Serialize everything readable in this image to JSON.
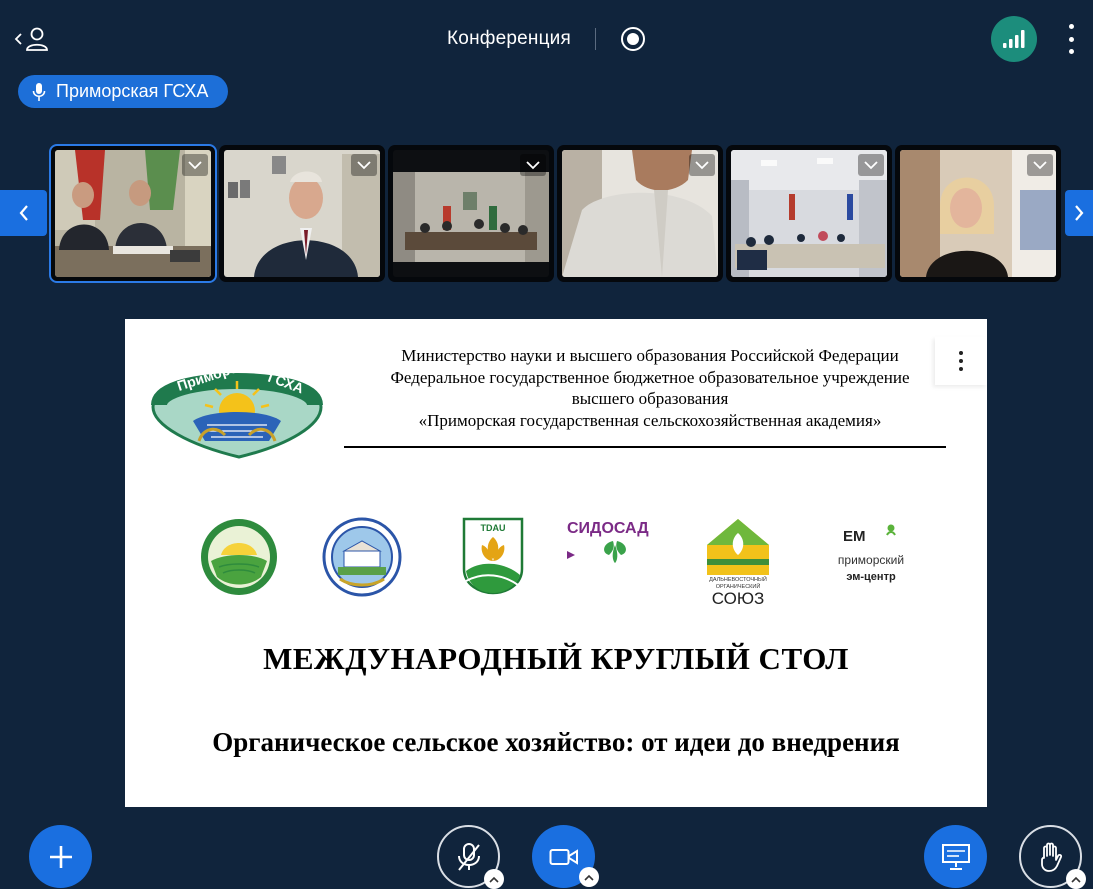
{
  "header": {
    "title": "Конференция"
  },
  "speaker": {
    "name": "Приморская ГСХА"
  },
  "strip": {
    "tiles": [
      {
        "scene": "two-men-at-desk",
        "active": true
      },
      {
        "scene": "man-in-suit-office"
      },
      {
        "scene": "conference-hall"
      },
      {
        "scene": "close-up-man"
      },
      {
        "scene": "meeting-room-table"
      },
      {
        "scene": "woman-window"
      }
    ]
  },
  "slide": {
    "gov_lines": [
      "Министерство науки и высшего образования Российской Федерации",
      "Федеральное государственное бюджетное образовательное учреждение",
      "высшего образования",
      "«Приморская государственная сельскохозяйственная академия»"
    ],
    "main_logo": {
      "lines": [
        "Приморская",
        "ГСХА"
      ]
    },
    "partner_logos": [
      {
        "id": "green-sun"
      },
      {
        "id": "blue-building"
      },
      {
        "id": "tdau",
        "text": "TDAU"
      },
      {
        "id": "sidosad",
        "text": "СИДОСАД"
      },
      {
        "id": "dv-union",
        "lines": [
          "ДАЛЬНЕВОСТОЧНЫЙ",
          "ОРГАНИЧЕСКИЙ",
          "СОЮЗ"
        ]
      },
      {
        "id": "em-center",
        "lines": [
          "ЕМ",
          "приморский",
          "эм-центр"
        ]
      }
    ],
    "title": "МЕЖДУНАРОДНЫЙ КРУГЛЫЙ СТОЛ",
    "subtitle": "Органическое сельское хозяйство: от идеи до внедрения"
  },
  "colors": {
    "background": "#10243c",
    "accent": "#1a6fe0",
    "signal": "#1c8d7c",
    "slide": "#ffffff"
  }
}
